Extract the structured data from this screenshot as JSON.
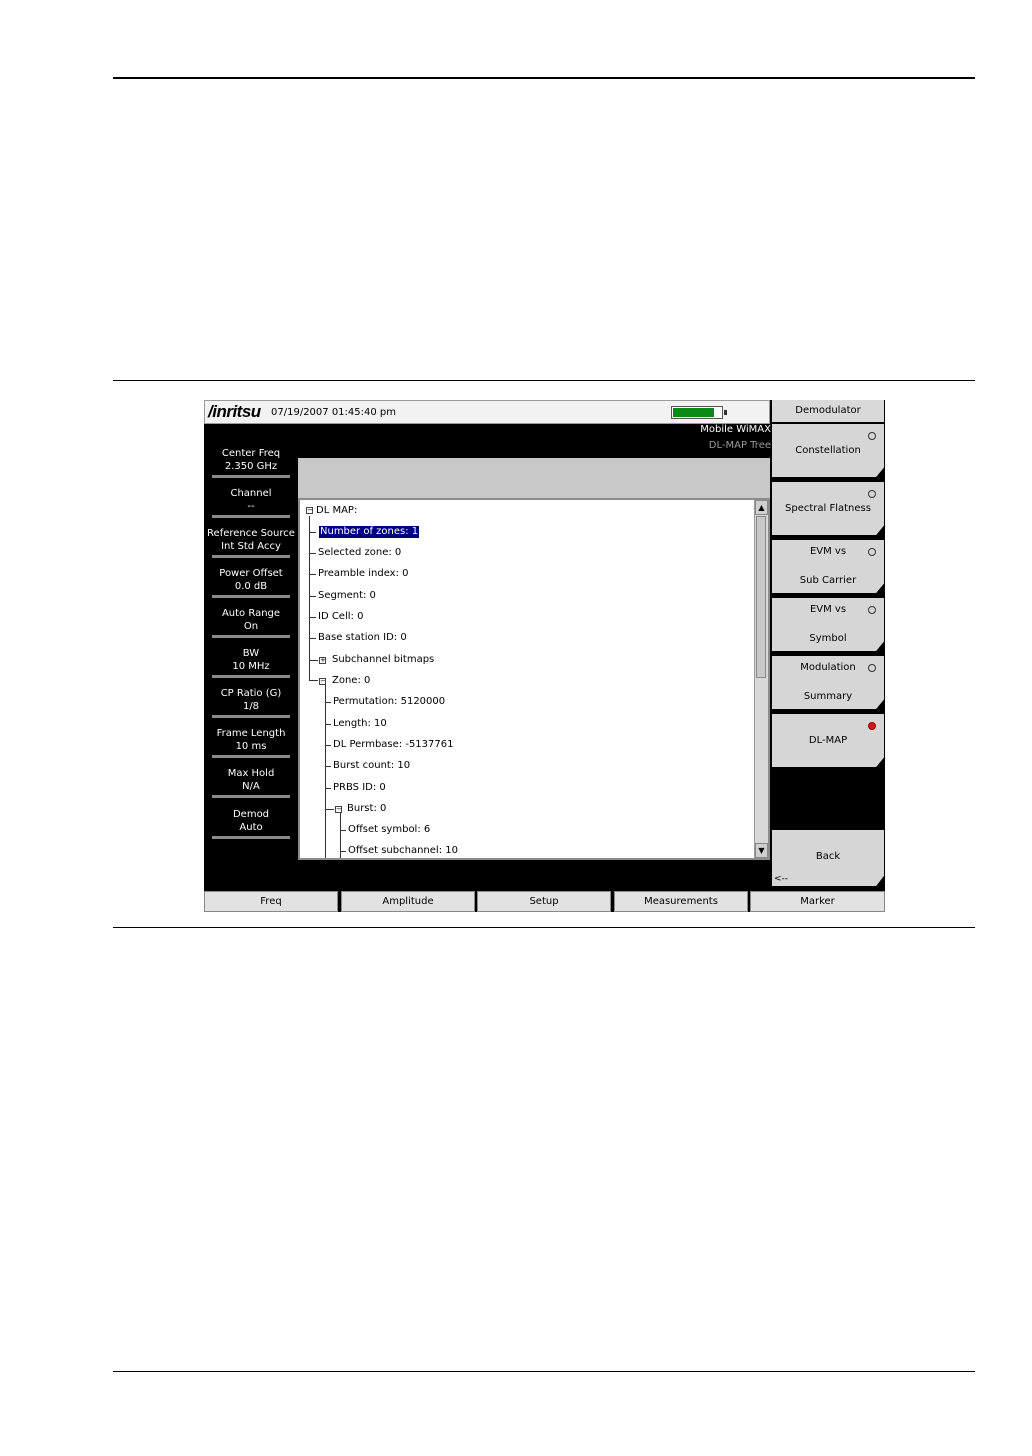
{
  "device": {
    "logo": "/inritsu",
    "datetime": "07/19/2007 01:45:40 pm",
    "battery_level": 0.85,
    "mode_title": "Mobile WiMAX",
    "mode_sub": "DL-MAP Tree"
  },
  "params": [
    {
      "label": "Center Freq",
      "value": "2.350 GHz"
    },
    {
      "label": "Channel",
      "value": "--"
    },
    {
      "label": "Reference Source",
      "value": "Int Std Accy"
    },
    {
      "label": "Power Offset",
      "value": "0.0 dB"
    },
    {
      "label": "Auto Range",
      "value": "On"
    },
    {
      "label": "BW",
      "value": "10 MHz"
    },
    {
      "label": "CP Ratio (G)",
      "value": "1/8"
    },
    {
      "label": "Frame Length",
      "value": "10 ms"
    },
    {
      "label": "Max Hold",
      "value": "N/A"
    },
    {
      "label": "Demod",
      "value": "Auto"
    }
  ],
  "tree": {
    "root": "DL MAP:",
    "number_of_zones": "Number of zones:  1",
    "selected_zone": "Selected zone:  0",
    "preamble_index": "Preamble index:  0",
    "segment": "Segment:  0",
    "id_cell": "ID Cell:  0",
    "base_station_id": "Base station ID:  0",
    "subchannel_bitmaps": "Subchannel bitmaps",
    "zone": "Zone:  0",
    "permutation": "Permutation:  5120000",
    "length": "Length:  10",
    "dl_permbase": "DL Permbase:  -5137761",
    "burst_count": "Burst count:  10",
    "prbs_id": "PRBS ID:  0",
    "burst": "Burst:  0",
    "offset_symbol": "Offset symbol:  6",
    "offset_subchannel": "Offset subchannel:  10"
  },
  "menu": {
    "title": "Demodulator",
    "keys": [
      {
        "line1": "Constellation",
        "line2": "",
        "state": "off"
      },
      {
        "line1": "Spectral Flatness",
        "line2": "",
        "state": "off"
      },
      {
        "line1": "EVM vs",
        "line2": "Sub Carrier",
        "state": "off"
      },
      {
        "line1": "EVM vs",
        "line2": "Symbol",
        "state": "off"
      },
      {
        "line1": "Modulation",
        "line2": "Summary",
        "state": "off"
      },
      {
        "line1": "DL-MAP",
        "line2": "",
        "state": "on"
      }
    ],
    "back_label": "Back",
    "back_arrow": "<--"
  },
  "bottom_menu": [
    "Freq",
    "Amplitude",
    "Setup",
    "Measurements",
    "Marker"
  ],
  "colors": {
    "battery": "#0c8a17",
    "selected_radio": "#d01818",
    "highlight": "#000080"
  }
}
